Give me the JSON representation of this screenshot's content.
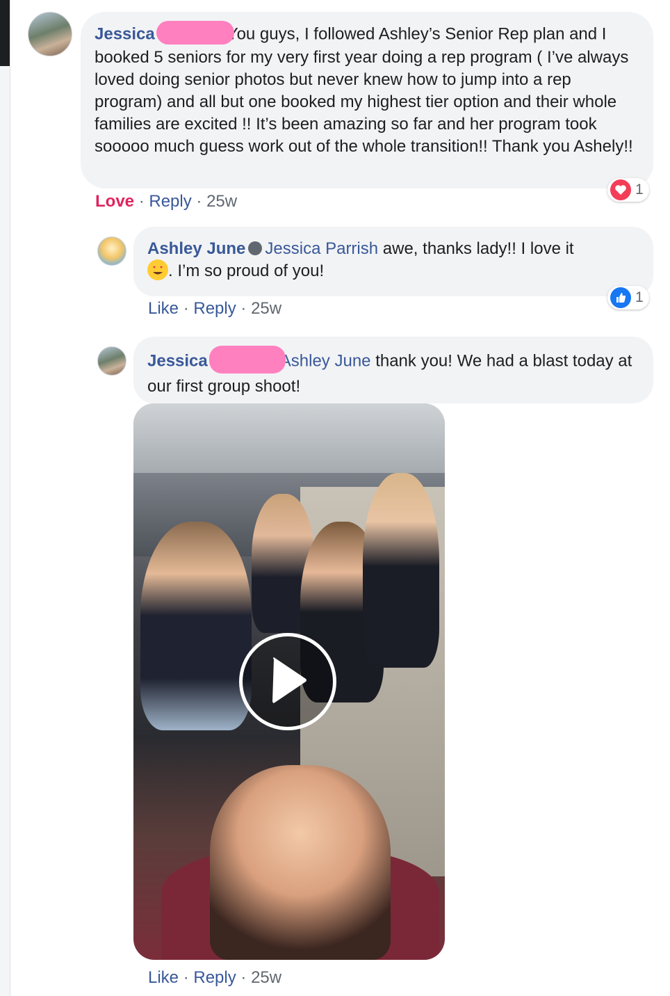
{
  "comment1": {
    "author": "Jessica",
    "text": "You guys, I followed Ashley’s Senior Rep plan and I booked 5 seniors for my very first year doing a rep program ( I’ve always loved doing senior photos but never knew how to jump into a rep program) and all but one booked my highest tier option and their whole families are excited !! It’s been amazing so far and her program took sooooo much guess work out of the whole transition!! Thank you Ashely!!",
    "reaction_label": "Love",
    "reply_label": "Reply",
    "time": "25w",
    "reaction_count": "1",
    "reaction_icon": "heart-icon"
  },
  "reply1": {
    "author": "Ashley June",
    "mention": "Jessica Parrish",
    "text_before_emoji": "awe, thanks lady!! I love it",
    "text_after_emoji": ". I’m so proud of you!",
    "like_label": "Like",
    "reply_label": "Reply",
    "time": "25w",
    "reaction_count": "1",
    "reaction_icon": "like-icon",
    "emoji": "heart-eyes-emoji"
  },
  "reply2": {
    "author": "Jessica",
    "mention": "Ashley June",
    "text": "thank you! We had a blast today at our first group shoot!",
    "like_label": "Like",
    "reply_label": "Reply",
    "time": "25w",
    "media_icon": "play-icon"
  },
  "colors": {
    "name": "#385898",
    "love": "#e0245e",
    "bubble": "#f2f3f5",
    "redaction": "#ff80bf"
  }
}
